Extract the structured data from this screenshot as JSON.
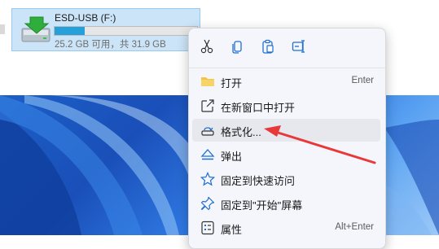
{
  "drive": {
    "name": "ESD-USB (F:)",
    "space_text": "25.2 GB 可用，共 31.9 GB",
    "used_fraction": 0.21,
    "icon": "usb-drive-icon"
  },
  "menu": {
    "toolbar": [
      {
        "name": "cut",
        "icon": "scissors-icon"
      },
      {
        "name": "copy",
        "icon": "copy-icon"
      },
      {
        "name": "paste",
        "icon": "paste-icon"
      },
      {
        "name": "rename",
        "icon": "rename-icon"
      }
    ],
    "items": [
      {
        "label": "打开",
        "shortcut": "Enter",
        "icon": "folder-icon"
      },
      {
        "label": "在新窗口中打开",
        "shortcut": "",
        "icon": "open-new-window-icon"
      },
      {
        "label": "格式化...",
        "shortcut": "",
        "icon": "format-drive-icon"
      },
      {
        "label": "弹出",
        "shortcut": "",
        "icon": "eject-icon"
      },
      {
        "label": "固定到快速访问",
        "shortcut": "",
        "icon": "star-icon"
      },
      {
        "label": "固定到\"开始\"屏幕",
        "shortcut": "",
        "icon": "pin-icon"
      },
      {
        "label": "属性",
        "shortcut": "Alt+Enter",
        "icon": "properties-icon"
      }
    ]
  },
  "colors": {
    "accent": "#26a0da",
    "annotation": "#e8393a"
  }
}
